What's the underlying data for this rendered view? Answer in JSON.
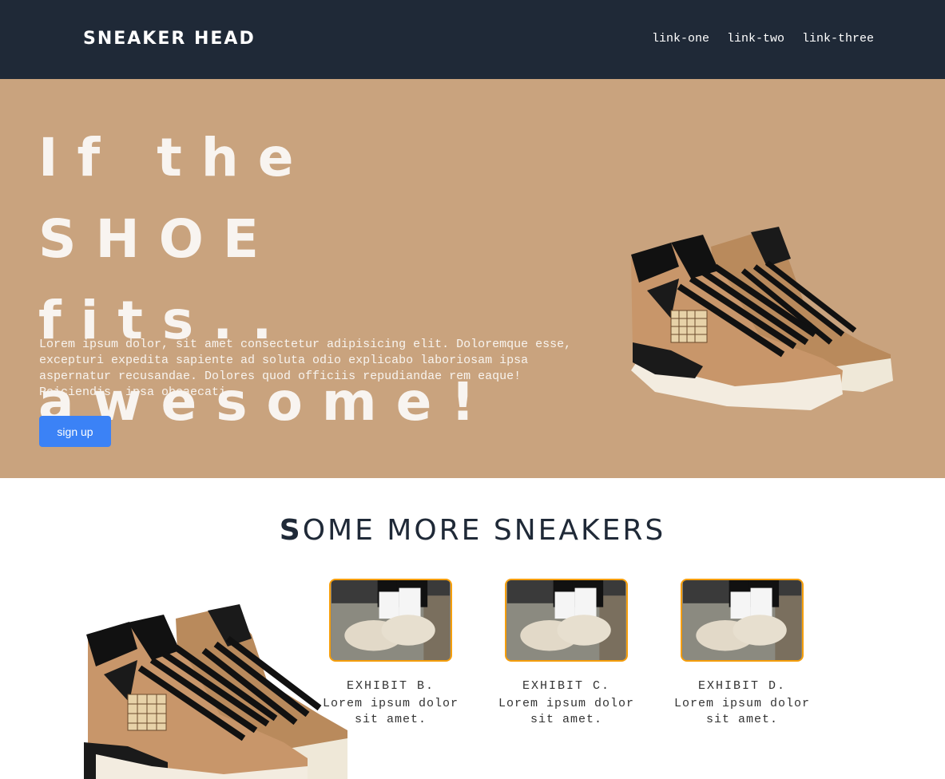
{
  "navbar": {
    "logo": "SNEAKER HEAD",
    "links": [
      "link-one",
      "link-two",
      "link-three"
    ],
    "background": "#1f2937"
  },
  "hero": {
    "title_line1": "If the SHOE",
    "title_line2": "fits..",
    "title_line3": "awesome!",
    "text": "Lorem ipsum dolor, sit amet consectetur adipisicing elit. Doloremque esse, excepturi expedita sapiente ad soluta odio explicabo laboriosam ipsa aspernatur recusandae. Dolores quod officiis repudiandae rem eaque! Reiciendis, ipsa obcaecati.",
    "signup_label": "sign up",
    "background": "#c9a37e",
    "button_color": "#3b82f6"
  },
  "section": {
    "title_first": "S",
    "title_rest": "OME MORE SNEAKERS"
  },
  "exhibits": [
    {
      "caption": "EXHIBIT B.",
      "desc": "Lorem ipsum dolor sit amet."
    },
    {
      "caption": "EXHIBIT C.",
      "desc": "Lorem ipsum dolor sit amet."
    },
    {
      "caption": "EXHIBIT D.",
      "desc": "Lorem ipsum dolor sit amet."
    }
  ],
  "colors": {
    "thumb_border": "#f59e0b"
  },
  "icons": {
    "hero_image": "sneaker-image",
    "exhibit_image": "sneaker-on-feet-image"
  }
}
